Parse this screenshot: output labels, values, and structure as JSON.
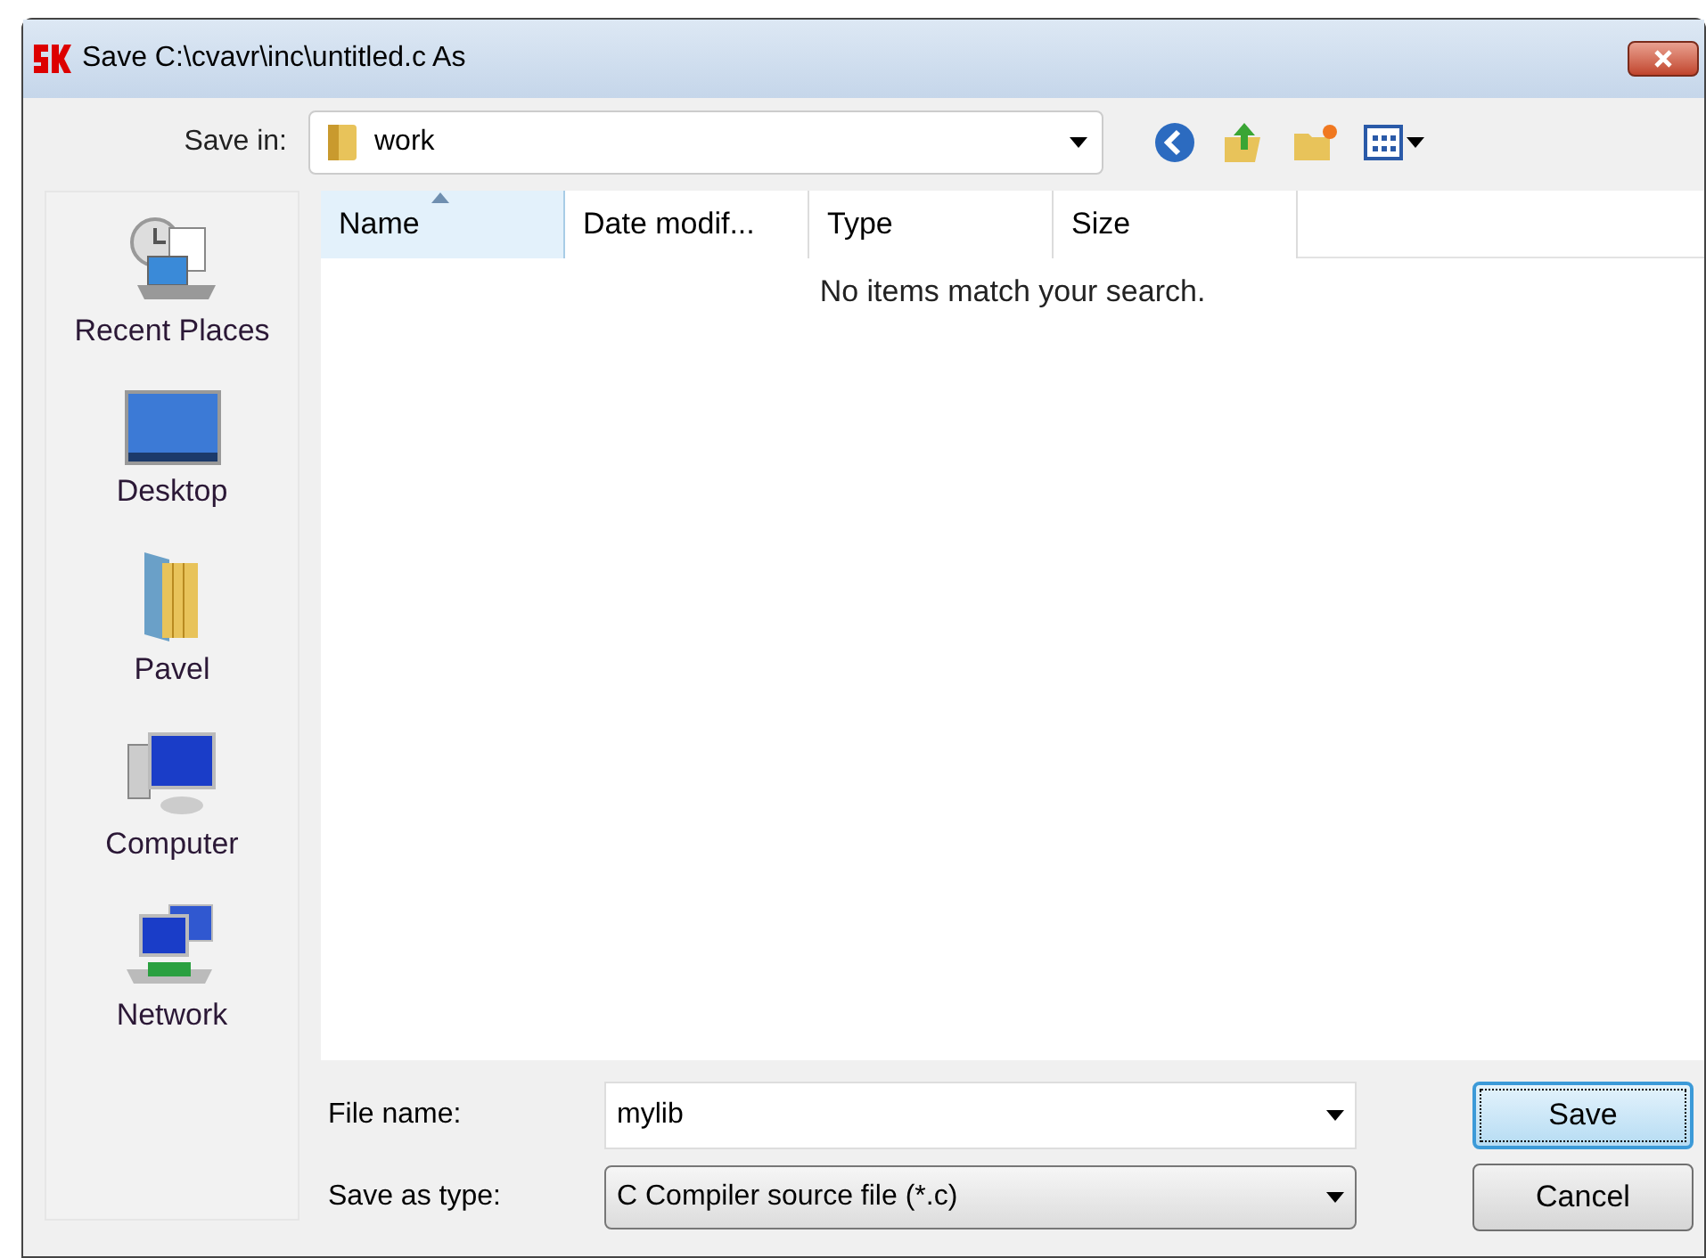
{
  "window": {
    "title": "Save C:\\cvavr\\inc\\untitled.c As"
  },
  "save_in": {
    "label": "Save in:",
    "value": "work"
  },
  "places": [
    {
      "label": "Recent Places",
      "kind": "recent"
    },
    {
      "label": "Desktop",
      "kind": "desktop"
    },
    {
      "label": "Pavel",
      "kind": "user"
    },
    {
      "label": "Computer",
      "kind": "computer"
    },
    {
      "label": "Network",
      "kind": "network"
    }
  ],
  "file_list": {
    "columns": [
      {
        "label": "Name",
        "sorted": true
      },
      {
        "label": "Date modif...",
        "sorted": false
      },
      {
        "label": "Type",
        "sorted": false
      },
      {
        "label": "Size",
        "sorted": false
      }
    ],
    "empty_message": "No items match your search."
  },
  "file_name": {
    "label": "File name:",
    "value": "mylib"
  },
  "save_as_type": {
    "label": "Save as type:",
    "value": "C Compiler source file (*.c)"
  },
  "buttons": [
    {
      "label": "Save",
      "default": true
    },
    {
      "label": "Cancel",
      "default": false
    }
  ]
}
